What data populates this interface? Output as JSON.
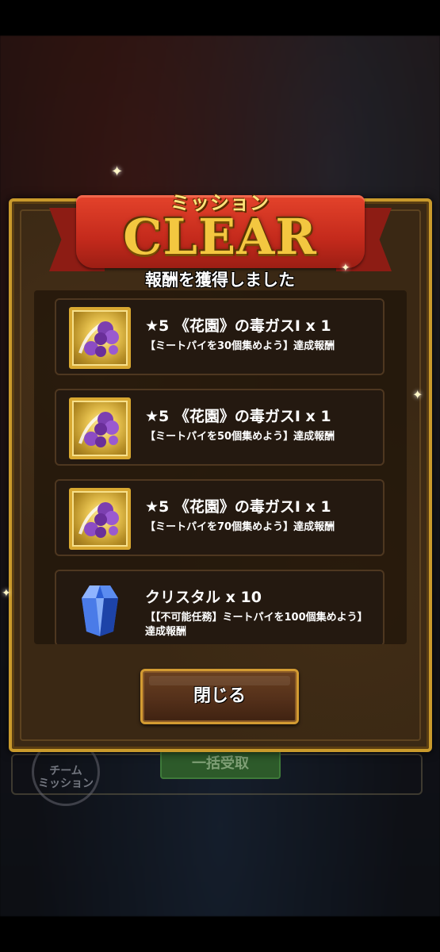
{
  "background": {
    "team_mission_label": "チーム\nミッション",
    "bulk_receive_label": "一括受取"
  },
  "modal": {
    "mission_label": "ミッション",
    "clear_label": "CLEAR",
    "subtitle": "報酬を獲得しました",
    "rewards": [
      {
        "icon": "poison-gas-icon",
        "title": "★5 《花園》の毒ガスⅠ x 1",
        "description": "【ミートパイを30個集めよう】達成報酬"
      },
      {
        "icon": "poison-gas-icon",
        "title": "★5 《花園》の毒ガスⅠ x 1",
        "description": "【ミートパイを50個集めよう】達成報酬"
      },
      {
        "icon": "poison-gas-icon",
        "title": "★5 《花園》の毒ガスⅠ x 1",
        "description": "【ミートパイを70個集めよう】達成報酬"
      },
      {
        "icon": "crystal-icon",
        "title": "クリスタル x 10",
        "description": "【【不可能任務】ミートパイを100個集めよう】達成報酬"
      }
    ],
    "close_label": "閉じる"
  },
  "colors": {
    "frame_gold": "#c99a2c",
    "ribbon_red": "#c42a1c",
    "panel_brown": "#3a2814"
  }
}
